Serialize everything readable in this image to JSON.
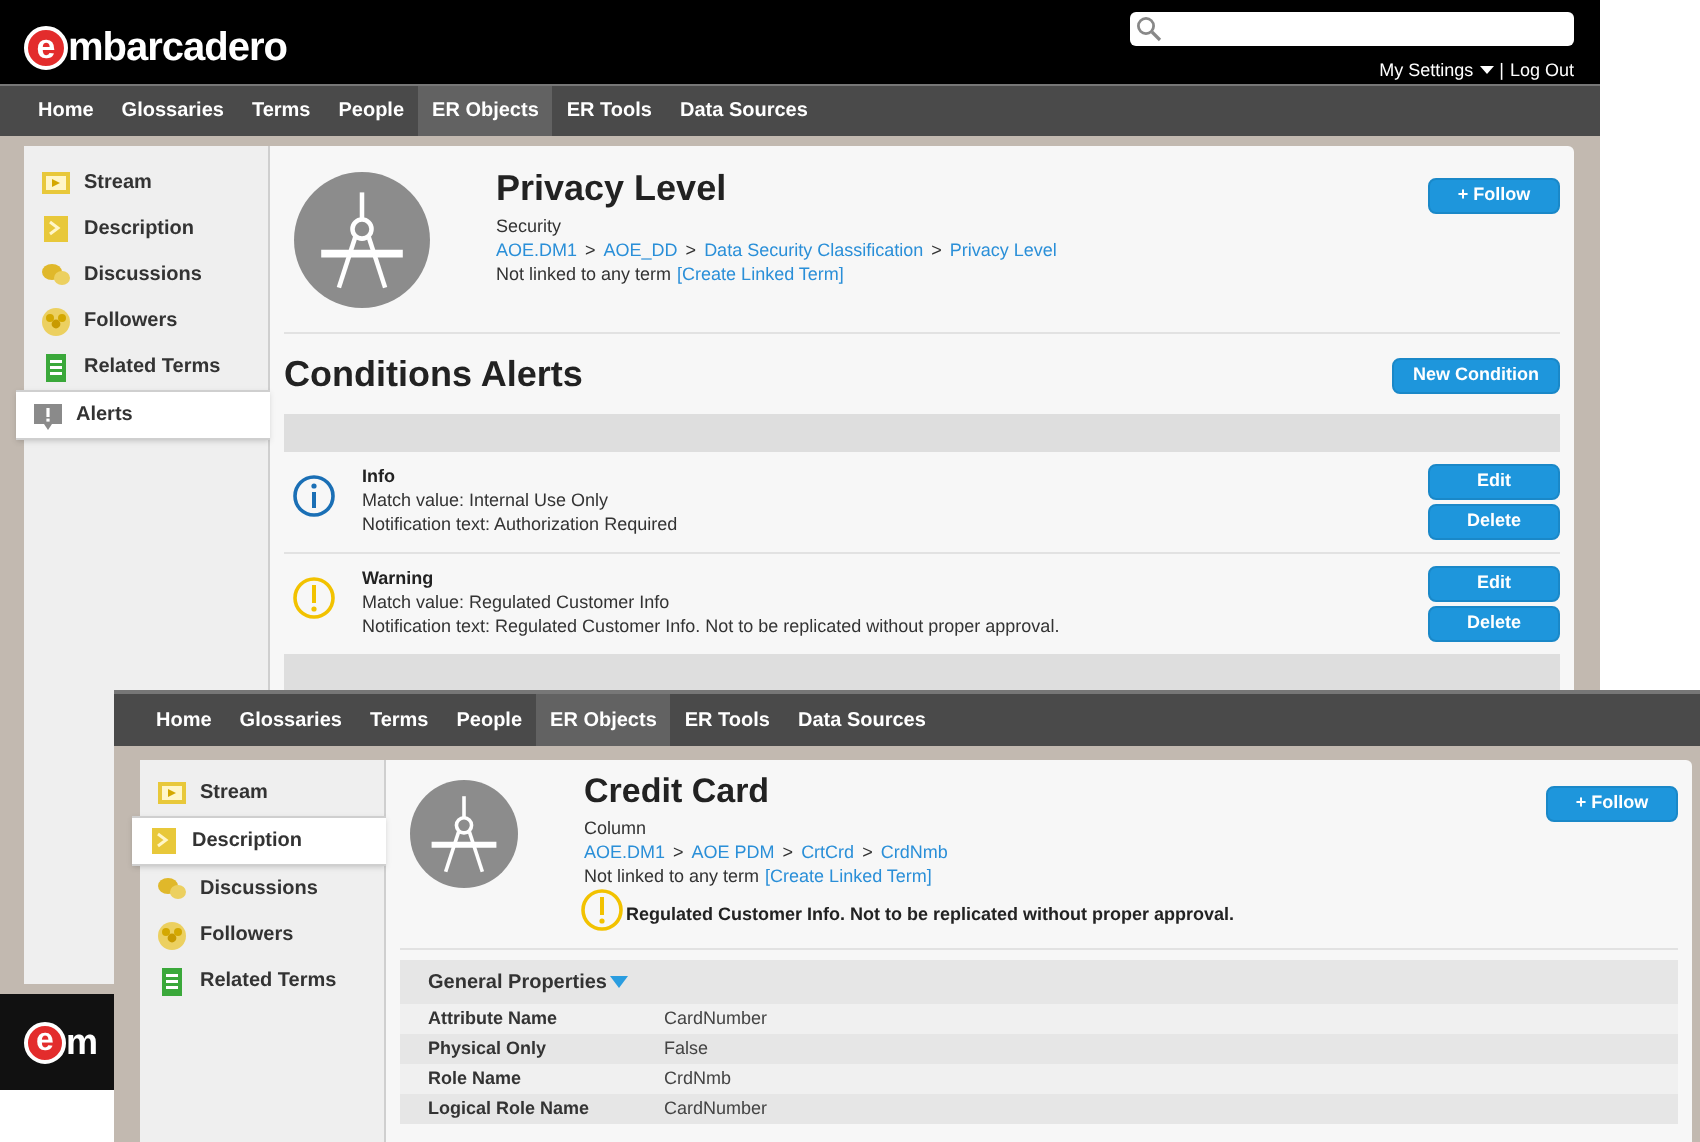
{
  "back_window": {
    "logo": {
      "mark": "e",
      "text": "mbarcadero"
    },
    "user_menu": {
      "settings": "My Settings",
      "separator": "|",
      "logout": "Log Out"
    },
    "nav": [
      {
        "label": "Home",
        "selected": false
      },
      {
        "label": "Glossaries",
        "selected": false
      },
      {
        "label": "Terms",
        "selected": false
      },
      {
        "label": "People",
        "selected": false
      },
      {
        "label": "ER Objects",
        "selected": true
      },
      {
        "label": "ER Tools",
        "selected": false
      },
      {
        "label": "Data Sources",
        "selected": false
      }
    ],
    "sidebar": [
      {
        "label": "Stream",
        "kind": "stream",
        "selected": false
      },
      {
        "label": "Description",
        "kind": "description",
        "selected": false
      },
      {
        "label": "Discussions",
        "kind": "discussions",
        "selected": false
      },
      {
        "label": "Followers",
        "kind": "followers",
        "selected": false
      },
      {
        "label": "Related Terms",
        "kind": "related",
        "selected": false
      },
      {
        "label": "Alerts",
        "kind": "alerts",
        "selected": true
      }
    ],
    "header": {
      "title": "Privacy Level",
      "type": "Security",
      "separator": ">",
      "breadcrumb": [
        "AOE.DM1",
        "AOE_DD",
        "Data Security Classification",
        "Privacy Level"
      ],
      "link_status": "Not linked to any term",
      "link_action": "[Create Linked Term]",
      "follow_button": "+ Follow"
    },
    "section_title": "Conditions Alerts",
    "new_button": "New Condition",
    "alerts": [
      {
        "kind": "info",
        "title": "Info",
        "match": "Match value: Internal Use Only",
        "notification": "Notification text: Authorization Required",
        "edit": "Edit",
        "delete": "Delete"
      },
      {
        "kind": "warning",
        "title": "Warning",
        "match": "Match value: Regulated Customer Info",
        "notification": "Notification text: Regulated Customer Info. Not to be replicated without proper approval.",
        "edit": "Edit",
        "delete": "Delete"
      }
    ],
    "footer_logo": {
      "mark": "e",
      "text": "m"
    }
  },
  "front_window": {
    "nav": [
      {
        "label": "Home",
        "selected": false
      },
      {
        "label": "Glossaries",
        "selected": false
      },
      {
        "label": "Terms",
        "selected": false
      },
      {
        "label": "People",
        "selected": false
      },
      {
        "label": "ER Objects",
        "selected": true
      },
      {
        "label": "ER Tools",
        "selected": false
      },
      {
        "label": "Data Sources",
        "selected": false
      }
    ],
    "sidebar": [
      {
        "label": "Stream",
        "kind": "stream",
        "selected": false
      },
      {
        "label": "Description",
        "kind": "description",
        "selected": true
      },
      {
        "label": "Discussions",
        "kind": "discussions",
        "selected": false
      },
      {
        "label": "Followers",
        "kind": "followers",
        "selected": false
      },
      {
        "label": "Related Terms",
        "kind": "related",
        "selected": false
      }
    ],
    "header": {
      "title": "Credit Card",
      "type": "Column",
      "separator": ">",
      "breadcrumb": [
        "AOE.DM1",
        "AOE PDM",
        "CrtCrd",
        "CrdNmb"
      ],
      "link_status": "Not linked to any term",
      "link_action": "[Create Linked Term]",
      "warning": "Regulated Customer Info. Not to be replicated without proper approval.",
      "follow_button": "+ Follow"
    },
    "properties": {
      "title": "General Properties",
      "expanded": true,
      "rows": [
        {
          "name": "Attribute Name",
          "value": "CardNumber"
        },
        {
          "name": "Physical Only",
          "value": "False"
        },
        {
          "name": "Role Name",
          "value": "CrdNmb"
        },
        {
          "name": "Logical Role Name",
          "value": "CardNumber"
        }
      ]
    }
  }
}
